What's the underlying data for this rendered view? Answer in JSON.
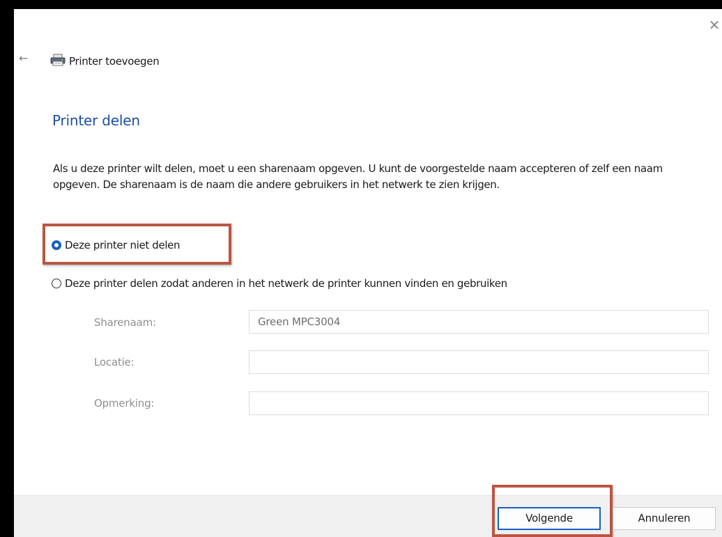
{
  "window": {
    "title": "Printer toevoegen",
    "close_symbol": "✕",
    "back_symbol": "←"
  },
  "page": {
    "heading": "Printer delen",
    "description": "Als u deze printer wilt delen, moet u een sharenaam opgeven. U kunt de voorgestelde naam accepteren of zelf een naam opgeven. De sharenaam is de naam die andere gebruikers in het netwerk te zien krijgen."
  },
  "options": {
    "no_share_label": "Deze printer niet delen",
    "no_share_selected": true,
    "share_label": "Deze printer delen zodat anderen in het netwerk de printer kunnen vinden en gebruiken",
    "share_selected": false
  },
  "fields": {
    "share_name_label": "Sharenaam:",
    "share_name_value": "Green MPC3004",
    "location_label": "Locatie:",
    "location_value": "",
    "comment_label": "Opmerking:",
    "comment_value": ""
  },
  "buttons": {
    "next_label": "Volgende",
    "cancel_label": "Annuleren"
  },
  "icons": {
    "window_icon": "printer-icon",
    "back": "back-arrow-icon",
    "close": "close-icon"
  },
  "colors": {
    "heading": "#1c4fa6",
    "accent": "#1b5fbf",
    "annotation": "#bb5542",
    "footer": "#f0f0f0"
  }
}
